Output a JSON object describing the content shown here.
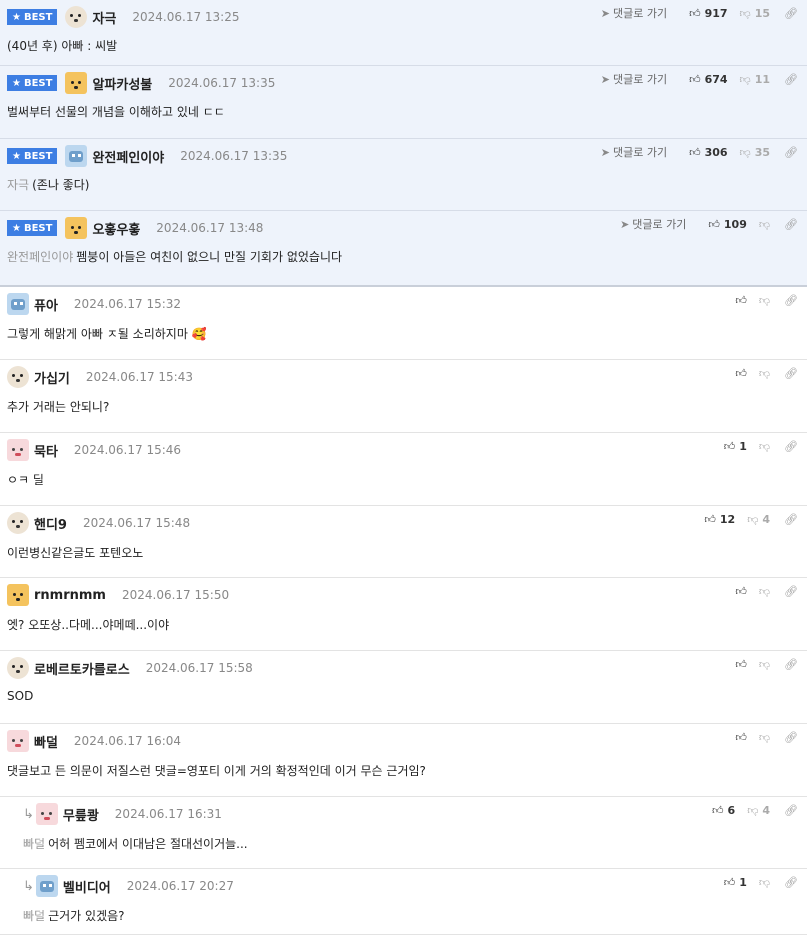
{
  "labels": {
    "best": "BEST",
    "reply_link": "댓글로 가기"
  },
  "icons": {
    "best_star": "star-icon",
    "thumb_up": "thumbs-up-icon",
    "thumb_down": "thumbs-down-icon",
    "link": "link-icon",
    "reply_arrow": "reply-arrow-icon",
    "go_reply": "send-icon"
  },
  "colors": {
    "best_badge": "#3d7ee3",
    "best_background": "#eef3fb",
    "mention_text": "#999999"
  },
  "comments": [
    {
      "best": true,
      "nick": "자극",
      "avatar": "pup",
      "date": "2024.06.17 13:25",
      "mention": "",
      "text": "(40년 후) 아빠 : 씨발",
      "likes": "917",
      "dislikes": "15"
    },
    {
      "best": true,
      "nick": "알파카성불",
      "avatar": "fox",
      "date": "2024.06.17 13:35",
      "mention": "",
      "text": "벌써부터 선물의 개념을 이해하고 있네 ㄷㄷ",
      "likes": "674",
      "dislikes": "11"
    },
    {
      "best": true,
      "nick": "완전페인이야",
      "avatar": "robot",
      "date": "2024.06.17 13:35",
      "mention": "자극",
      "text": "(존나 좋다)",
      "likes": "306",
      "dislikes": "35"
    },
    {
      "best": true,
      "nick": "오홓우홓",
      "avatar": "fox",
      "date": "2024.06.17 13:48",
      "mention": "완전페인이야",
      "text": "펨붕이 아들은 여친이 없으니 만질 기회가 없었습니다",
      "likes": "109",
      "dislikes": ""
    },
    {
      "best": false,
      "nick": "퓨아",
      "avatar": "robot",
      "date": "2024.06.17 15:32",
      "mention": "",
      "text": "그렇게 해맑게 아빠 ㅈ될 소리하지마 🥰",
      "likes": "",
      "dislikes": ""
    },
    {
      "best": false,
      "nick": "가십기",
      "avatar": "pup",
      "date": "2024.06.17 15:43",
      "mention": "",
      "text": "추가 거래는 안되니?",
      "likes": "",
      "dislikes": ""
    },
    {
      "best": false,
      "nick": "묵타",
      "avatar": "rabbit",
      "date": "2024.06.17 15:46",
      "mention": "",
      "text": "ㅇㅋ 딜",
      "likes": "1",
      "dislikes": ""
    },
    {
      "best": false,
      "nick": "핸디9",
      "avatar": "pup",
      "date": "2024.06.17 15:48",
      "mention": "",
      "text": "이런병신같은글도 포텐오노",
      "likes": "12",
      "dislikes": "4"
    },
    {
      "best": false,
      "nick": "rnmrnmm",
      "avatar": "fox",
      "date": "2024.06.17 15:50",
      "mention": "",
      "text": "엣? 오또상..다메...야메떼...이야",
      "likes": "",
      "dislikes": ""
    },
    {
      "best": false,
      "nick": "로베르토카를로스",
      "avatar": "pup",
      "date": "2024.06.17 15:58",
      "mention": "",
      "text": "SOD",
      "likes": "",
      "dislikes": ""
    },
    {
      "best": false,
      "nick": "빠덜",
      "avatar": "rabbit",
      "date": "2024.06.17 16:04",
      "mention": "",
      "text": "댓글보고 든 의문이 저질스런 댓글=영포티 이게 거의 확정적인데 이거 무슨 근거임?",
      "likes": "",
      "dislikes": ""
    },
    {
      "best": false,
      "reply": true,
      "nick": "무릎쾅",
      "avatar": "rabbit",
      "date": "2024.06.17 16:31",
      "mention": "빠덜",
      "text": "어허 펨코에서 이대남은 절대선이거늘...",
      "likes": "6",
      "dislikes": "4"
    },
    {
      "best": false,
      "reply": true,
      "nick": "벨비디어",
      "avatar": "robot",
      "date": "2024.06.17 20:27",
      "mention": "빠덜",
      "text": "근거가 있겠음?",
      "likes": "1",
      "dislikes": ""
    }
  ]
}
